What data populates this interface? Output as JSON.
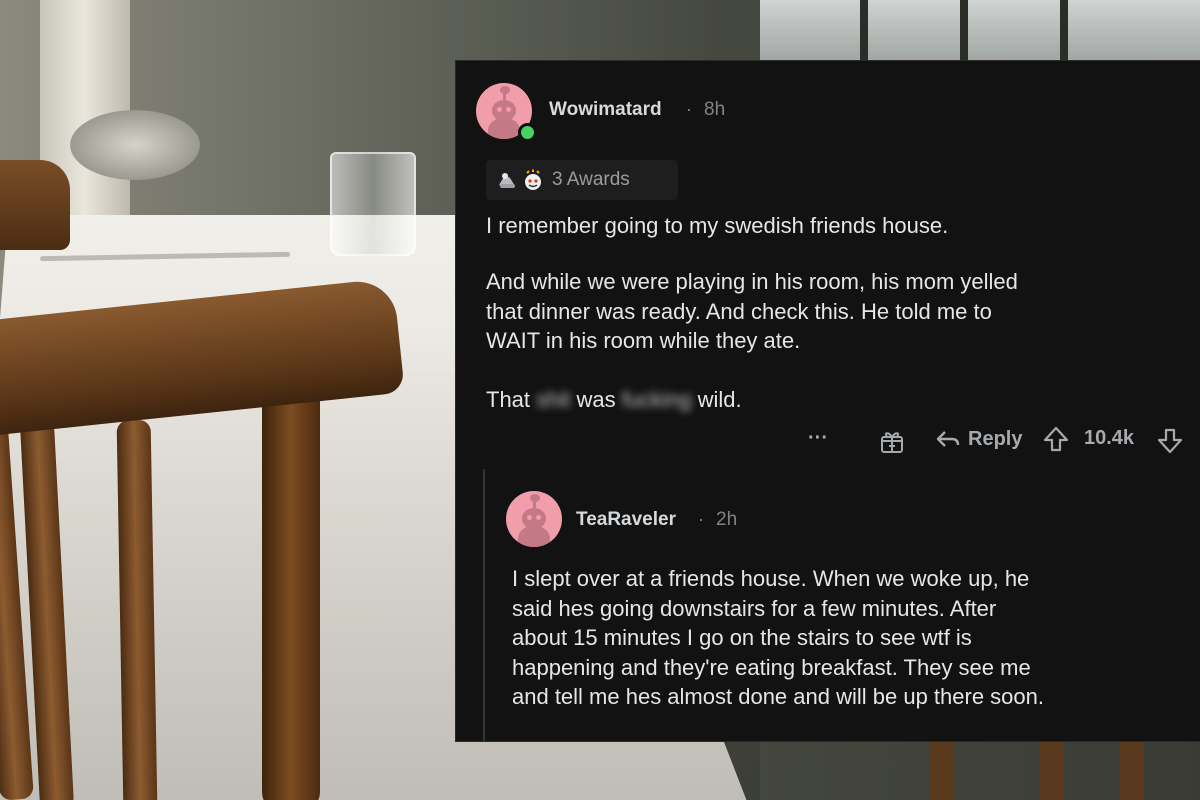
{
  "comment": {
    "username": "Wowimatard",
    "separator": "·",
    "time": "8h",
    "awards_label": "3 Awards",
    "paragraphs": {
      "p1": "I remember going to my swedish friends house.",
      "p2_l1": "And while we were playing in his room, his mom yelled",
      "p2_l2": "that dinner was ready. And check this. He told me to",
      "p2_l3": "WAIT in his room while they ate.",
      "p3_a": "That",
      "p3_blur1": "shit",
      "p3_b": "was",
      "p3_blur2": "fucking",
      "p3_c": "wild."
    },
    "actions": {
      "more_label": "···",
      "reply_label": "Reply",
      "vote_count": "10.4k"
    }
  },
  "reply": {
    "username": "TeaRaveler",
    "separator": "·",
    "time": "2h",
    "lines": {
      "l1": "I slept over at a friends house. When we woke up, he",
      "l2": "said hes going downstairs for a few minutes. After",
      "l3": "about 15 minutes I go on the stairs to see wtf is",
      "l4": "happening and they're eating breakfast. They see me",
      "l5": "and tell me hes almost done and will be up there soon."
    }
  },
  "colors": {
    "card_bg": "#121212",
    "text": "#e4e6e7",
    "muted": "#818384",
    "avatar_pink": "#f29eaa",
    "online_green": "#46d160"
  },
  "icons": [
    "award-icon",
    "gift-icon",
    "reply-arrow-icon",
    "upvote-icon",
    "downvote-icon",
    "more-icon",
    "snoo-avatar-icon"
  ]
}
